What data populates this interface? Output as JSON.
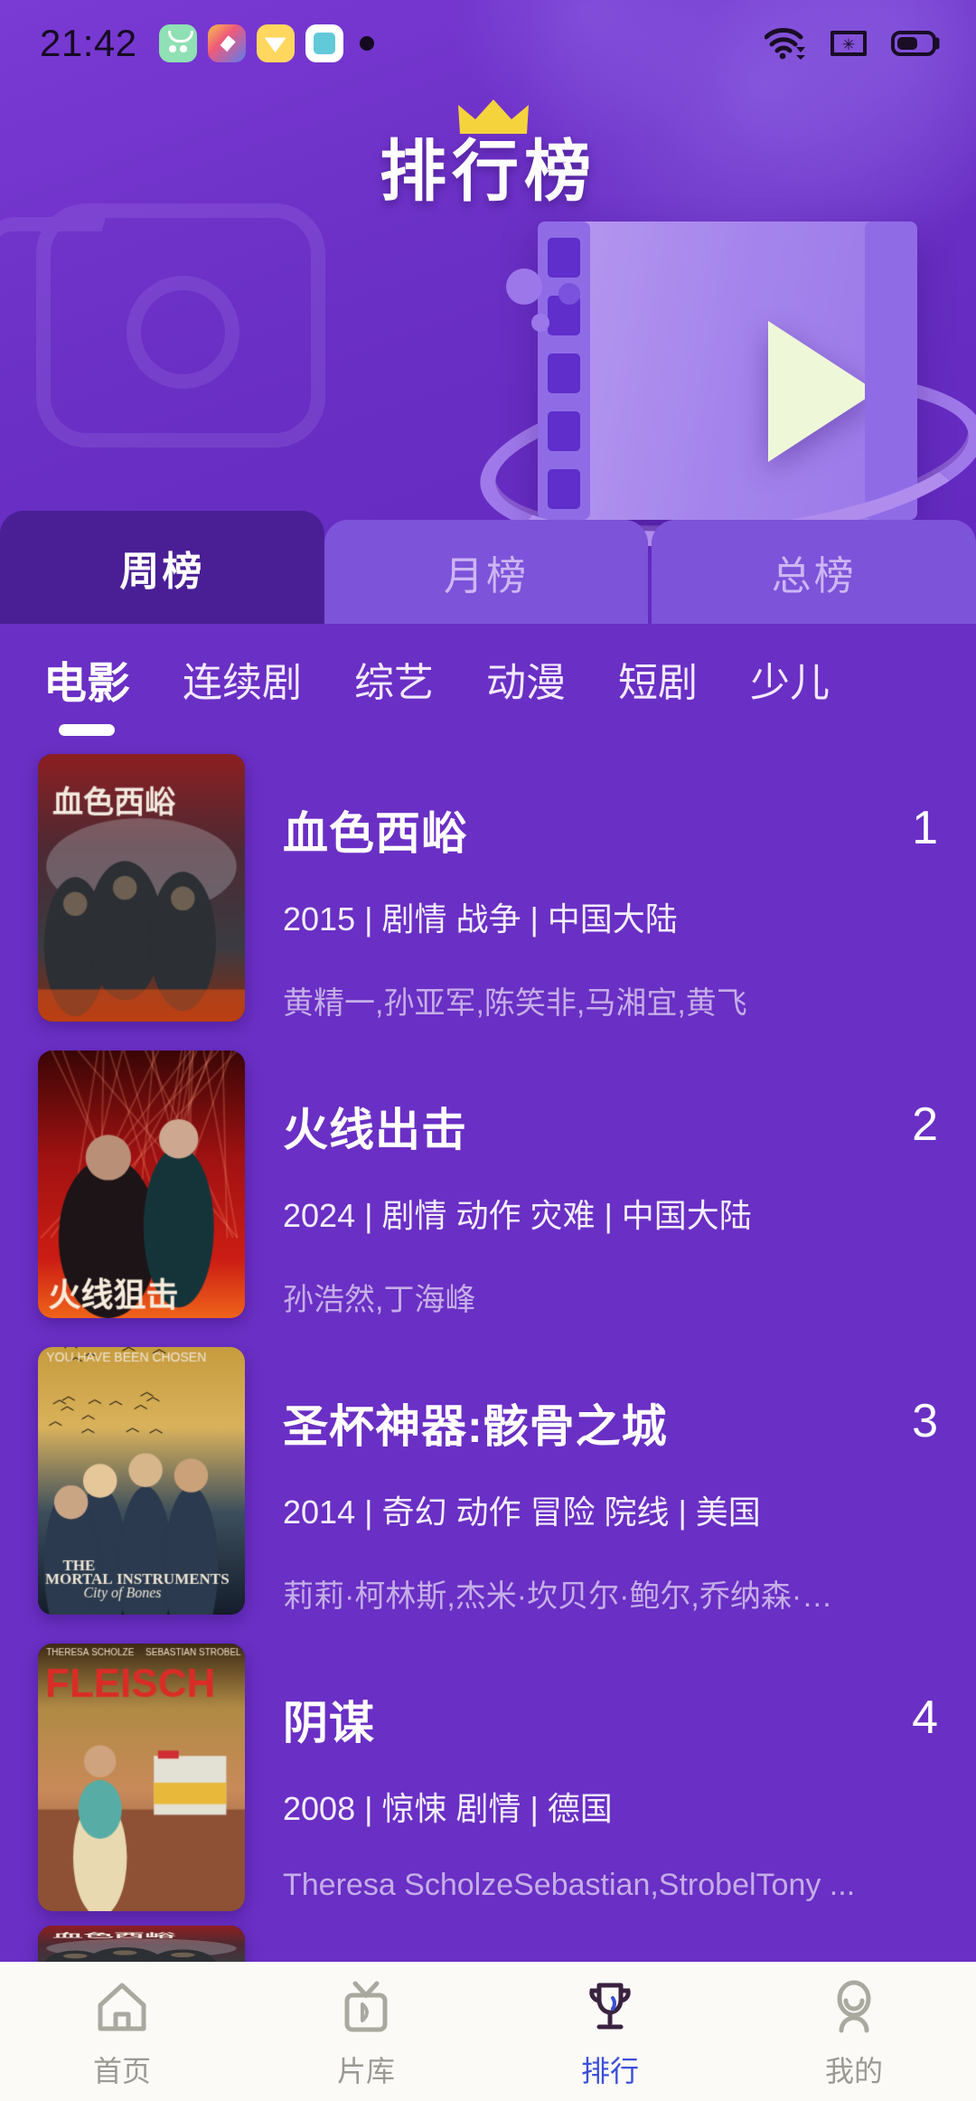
{
  "status_bar": {
    "clock": "21:42",
    "app_icons": [
      "appstore-icon",
      "edit-icon",
      "diamond-icon",
      "transfer-icon"
    ],
    "right_icons": [
      "wifi-icon",
      "sim-card-off-icon",
      "battery-icon"
    ]
  },
  "header": {
    "title": "排行榜",
    "crown_color": "#f5d33c",
    "illustration": "film-strip-play-3d"
  },
  "period_tabs": [
    {
      "label": "周榜",
      "active": true
    },
    {
      "label": "月榜",
      "active": false
    },
    {
      "label": "总榜",
      "active": false
    }
  ],
  "categories": [
    {
      "label": "电影",
      "active": true
    },
    {
      "label": "连续剧",
      "active": false
    },
    {
      "label": "综艺",
      "active": false
    },
    {
      "label": "动漫",
      "active": false
    },
    {
      "label": "短剧",
      "active": false
    },
    {
      "label": "少儿",
      "active": false
    }
  ],
  "ranking_list": [
    {
      "rank": "1",
      "title": "血色西峪",
      "info": "2015 | 剧情 战争 | 中国大陆",
      "cast": "黄精一,孙亚军,陈笑非,马湘宜,黄飞",
      "poster_style": "war-dark-red"
    },
    {
      "rank": "2",
      "title": "火线出击",
      "info": "2024 | 剧情 动作 灾难 | 中国大陆",
      "cast": "孙浩然,丁海峰",
      "poster_style": "action-red"
    },
    {
      "rank": "3",
      "title": "圣杯神器:骸骨之城",
      "info": "2014 | 奇幻 动作 冒险 院线 | 美国",
      "cast": "莉莉·柯林斯,杰米·坎贝尔·鲍尔,乔纳森·莱...",
      "poster_style": "fantasy-gold"
    },
    {
      "rank": "4",
      "title": "阴谋",
      "info": "2008 | 惊悚 剧情 | 德国",
      "cast": "Theresa ScholzeSebastian,StrobelTony ...",
      "poster_style": "thriller-sunset"
    }
  ],
  "bottom_nav": [
    {
      "label": "首页",
      "icon": "home-icon",
      "active": false
    },
    {
      "label": "片库",
      "icon": "tv-icon",
      "active": false
    },
    {
      "label": "排行",
      "icon": "trophy-icon",
      "active": true
    },
    {
      "label": "我的",
      "icon": "person-icon",
      "active": false
    }
  ],
  "colors": {
    "background": "#6a2fc4",
    "tab_active": "#4a1f96",
    "tab_inactive": "#7d53d9",
    "accent_blue": "#3b4fd8",
    "nav_bar": "#fbfaf7"
  }
}
